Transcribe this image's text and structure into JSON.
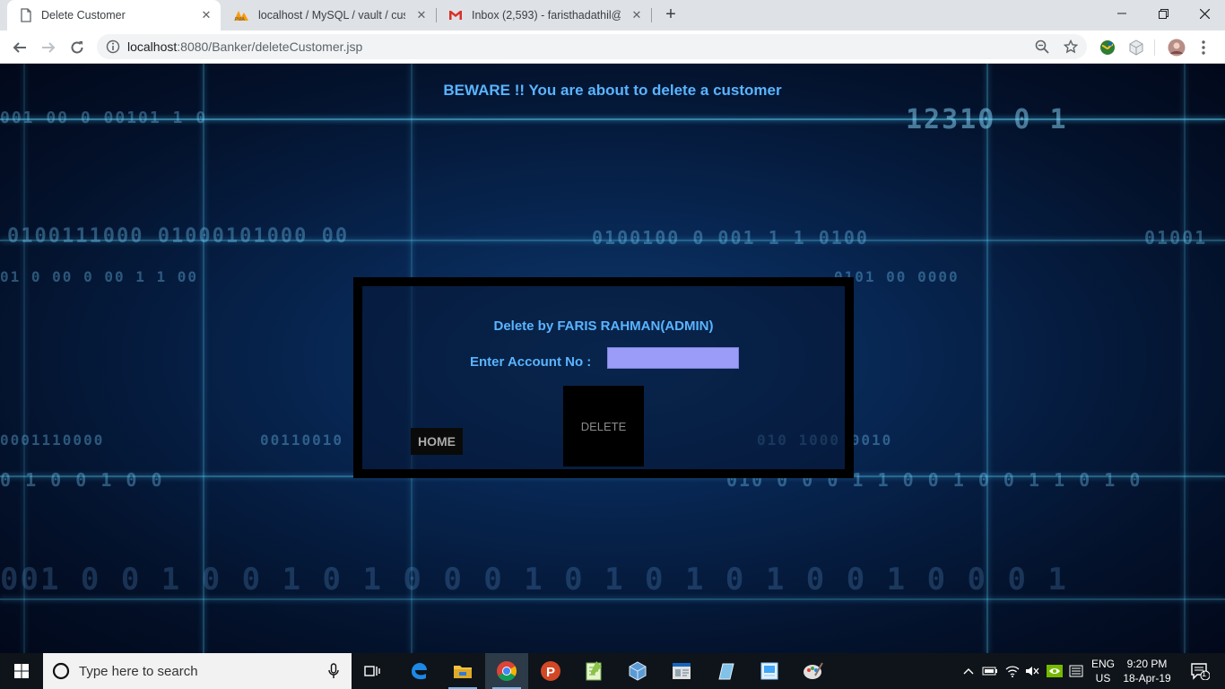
{
  "browser": {
    "tabs": [
      {
        "title": "Delete Customer",
        "icon": "page-icon",
        "active": true
      },
      {
        "title": "localhost / MySQL / vault / custo",
        "icon": "phpmyadmin-icon",
        "active": false
      },
      {
        "title": "Inbox (2,593) - faristhadathil@gm",
        "icon": "gmail-icon",
        "active": false
      }
    ],
    "new_tab_label": "+",
    "url_host": "localhost",
    "url_rest": ":8080/Banker/deleteCustomer.jsp"
  },
  "page": {
    "warning": "BEWARE !! You are about to delete a customer",
    "panel_title": "Delete by FARIS RAHMAN(ADMIN)",
    "account_label": "Enter Account No :",
    "account_value": "",
    "delete_label": "DELETE",
    "home_label": "HOME",
    "background_colors": {
      "accent": "#5ab4ff",
      "input": "#9a9cf8"
    }
  },
  "taskbar": {
    "search_placeholder": "Type here to search",
    "lang_primary": "ENG",
    "lang_secondary": "US",
    "time": "9:20 PM",
    "date": "18-Apr-19",
    "notification_count": "1",
    "apps": [
      "task-view-icon",
      "edge-icon",
      "file-explorer-icon",
      "chrome-icon",
      "powerpoint-icon",
      "notepadpp-icon",
      "virtualbox-icon",
      "app-window-icon",
      "edit-icon",
      "photos-icon",
      "paint-icon"
    ]
  }
}
